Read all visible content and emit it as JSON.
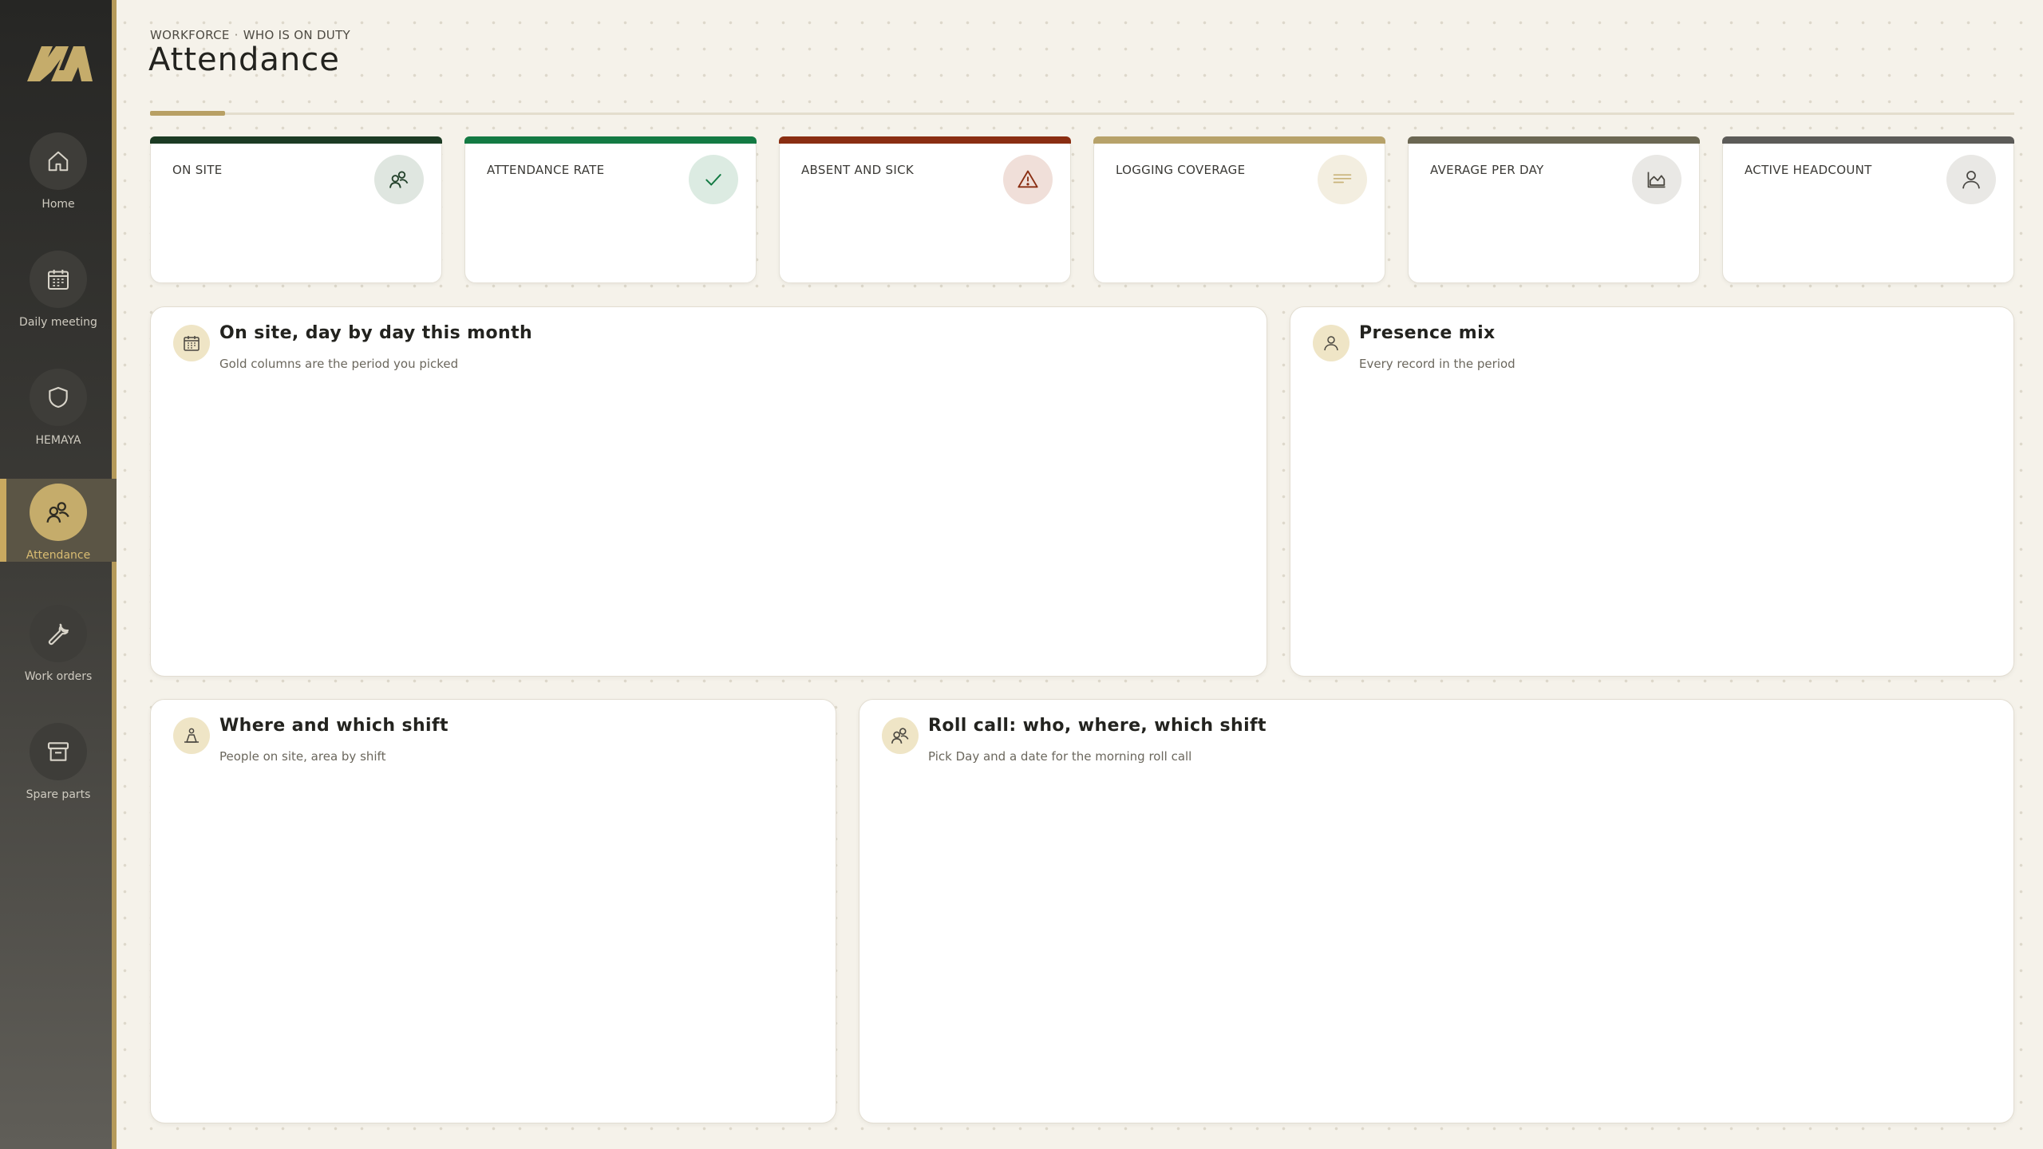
{
  "sidebar": {
    "logo_name": "brand-logo",
    "items": [
      {
        "label": "Home",
        "icon": "home-icon"
      },
      {
        "label": "Daily meeting",
        "icon": "calendar-icon"
      },
      {
        "label": "HEMAYA",
        "icon": "shield-icon"
      },
      {
        "label": "Attendance",
        "icon": "people-icon",
        "active": true
      },
      {
        "label": "Work orders",
        "icon": "wrench-icon"
      },
      {
        "label": "Spare parts",
        "icon": "archive-box-icon"
      }
    ]
  },
  "header": {
    "breadcrumb": [
      "WORKFORCE",
      "WHO IS ON DUTY"
    ],
    "breadcrumb_separator": "·",
    "title": "Attendance"
  },
  "kpis": [
    {
      "label": "ON SITE",
      "icon": "people-icon",
      "bar_color": "#1c3b24"
    },
    {
      "label": "ATTENDANCE RATE",
      "icon": "check-icon",
      "bar_color": "#137a43"
    },
    {
      "label": "ABSENT AND SICK",
      "icon": "warning-icon",
      "bar_color": "#8a2e12"
    },
    {
      "label": "LOGGING COVERAGE",
      "icon": "lines-icon",
      "bar_color": "#b7a26a"
    },
    {
      "label": "AVERAGE PER DAY",
      "icon": "area-chart-icon",
      "bar_color": "#6b6753"
    },
    {
      "label": "ACTIVE HEADCOUNT",
      "icon": "person-icon",
      "bar_color": "#5c5b58"
    }
  ],
  "panels": {
    "daily": {
      "title": "On site, day by day this month",
      "subtitle": "Gold columns are the period you picked",
      "icon": "calendar-icon"
    },
    "mix": {
      "title": "Presence mix",
      "subtitle": "Every record in the period",
      "icon": "person-icon"
    },
    "shift": {
      "title": "Where and which shift",
      "subtitle": "People on site, area by shift",
      "icon": "user-location-icon"
    },
    "rollcall": {
      "title": "Roll call: who, where, which shift",
      "subtitle": "Pick Day and a date for the morning roll call",
      "icon": "people-icon"
    }
  },
  "colors": {
    "accent_gold": "#b8a064",
    "sidebar_bg": "#2a2a28",
    "page_bg": "#f5f2ea"
  }
}
